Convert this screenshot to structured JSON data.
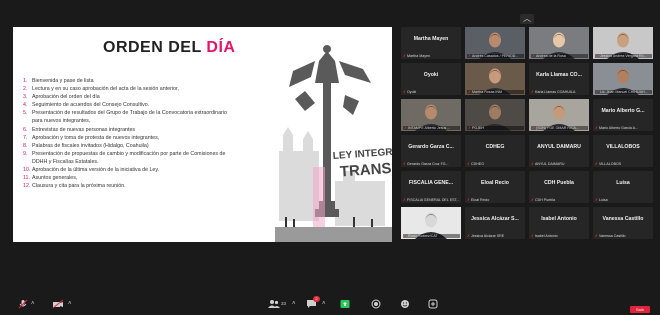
{
  "slide": {
    "title_main": "ORDEN DEL ",
    "title_accent": "DÍA",
    "sign_line1": "LEY INTEGRAL",
    "sign_line2": "TRANS",
    "agenda": [
      {
        "num": "1.",
        "text": "Bienvenida y pase de lista"
      },
      {
        "num": "2.",
        "text": "Lectura y en su caso aprobación del acta de la sesión anterior,"
      },
      {
        "num": "3.",
        "text": "Aprobación del orden del día"
      },
      {
        "num": "4.",
        "text": "Seguimiento de acuerdos del Consejo Consultivo."
      },
      {
        "num": "5.",
        "text": "Presentación de resultados del Grupo de Trabajo de la Convocatoria extraordinario"
      },
      {
        "num": "",
        "text": "para nuevos integrantes,"
      },
      {
        "num": "6.",
        "text": "Entrevistas de nuevas personas integrantes"
      },
      {
        "num": "7.",
        "text": "Aprobación y toma de protesta de nuevos integrantes,"
      },
      {
        "num": "8.",
        "text": "Palabras de fiscales invitados (Hidalgo, Coahuila)"
      },
      {
        "num": "9.",
        "text": "Presentación de propuestas de cambio y modificación por parte de Comisiones de"
      },
      {
        "num": "",
        "text": "DDHH y Fiscalías Estatales."
      },
      {
        "num": "10.",
        "text": "Aprobación de la última versión de la iniciativa de Ley."
      },
      {
        "num": "11.",
        "text": "Asuntos generales,"
      },
      {
        "num": "12.",
        "text": "Clausura y cita para la próxima reunión."
      }
    ]
  },
  "participants": [
    {
      "name": "Martha Mayen",
      "label": "Martha Mayen",
      "video": false
    },
    {
      "name": "",
      "label": "Andrés Casados / PERIOD...",
      "video": true,
      "skin": "#b98a6e",
      "bg": "#5a5f66"
    },
    {
      "name": "",
      "label": "Andrea de la Rosa",
      "video": true,
      "skin": "#e6c7a8",
      "bg": "#7b7c80"
    },
    {
      "name": "",
      "label": "Jessica Andrea Vergara Ró...",
      "video": true,
      "skin": "#caa080",
      "bg": "#c8c8c8"
    },
    {
      "name": "Oyoki",
      "label": "Oyoki",
      "video": false
    },
    {
      "name": "",
      "label": "Martha Rosas INM",
      "video": true,
      "skin": "#c79a7c",
      "bg": "#6a5a4a"
    },
    {
      "name": "Karla Llamas CO...",
      "label": "Karla Llamas COAHUILA",
      "video": false
    },
    {
      "name": "",
      "label": "Lic. Juan Manuel CHIHUAH...",
      "video": true,
      "skin": "#b08060",
      "bg": "#8a8f96"
    },
    {
      "name": "",
      "label": "INTAMPE Alberto Jesús ...",
      "video": true,
      "skin": "#b68a6b",
      "bg": "#6f6a63"
    },
    {
      "name": "",
      "label": "PGJEH",
      "video": true,
      "skin": "#9f7b62",
      "bg": "#4e4a45"
    },
    {
      "name": "",
      "label": "(SON) FGE OMAR RICA...",
      "video": true,
      "skin": "#c39a7a",
      "bg": "#a8a59e"
    },
    {
      "name": "Mario Alberto G...",
      "label": "Mario Alberto Garcia A...",
      "video": false
    },
    {
      "name": "Gerardo Garza C...",
      "label": "Gerardo Garza Cruz FG...",
      "video": false
    },
    {
      "name": "CDHEG",
      "label": "CDHEG",
      "video": false
    },
    {
      "name": "ANYUL DAIMARU",
      "label": "ANYUL DAIMARU",
      "video": false
    },
    {
      "name": "VILLALOBOS",
      "label": "VILLALOBOS",
      "video": false
    },
    {
      "name": "FISCALIA GENE...",
      "label": "FISCALIA GENERAL DEL EST...",
      "video": false
    },
    {
      "name": "Eloal Recio",
      "label": "Eloal Recio",
      "video": false
    },
    {
      "name": "CDH Puebla",
      "label": "CDH Puebla",
      "video": false
    },
    {
      "name": "Luisa",
      "label": "Luisa",
      "video": false
    },
    {
      "name": "",
      "label": "Rocío Suárez/CAT",
      "video": true,
      "skin": "#d8d8d8",
      "bg": "#e8e8e8"
    },
    {
      "name": "Jessica Alcázar S...",
      "label": "Jessica Alcázar SRE",
      "video": false
    },
    {
      "name": "Isabel Antonio",
      "label": "Isabel Antonio",
      "video": false
    },
    {
      "name": "Vanessa Castillo",
      "label": "Vanessa Castillo",
      "video": false
    }
  ],
  "toolbar": {
    "participants_count": "33",
    "chat_badge": "2",
    "leave_label": "Salir"
  },
  "colors": {
    "accent": "#e0156d",
    "muted_mic": "#e12b3f",
    "leave": "#e0243b",
    "share": "#2ec45a"
  }
}
